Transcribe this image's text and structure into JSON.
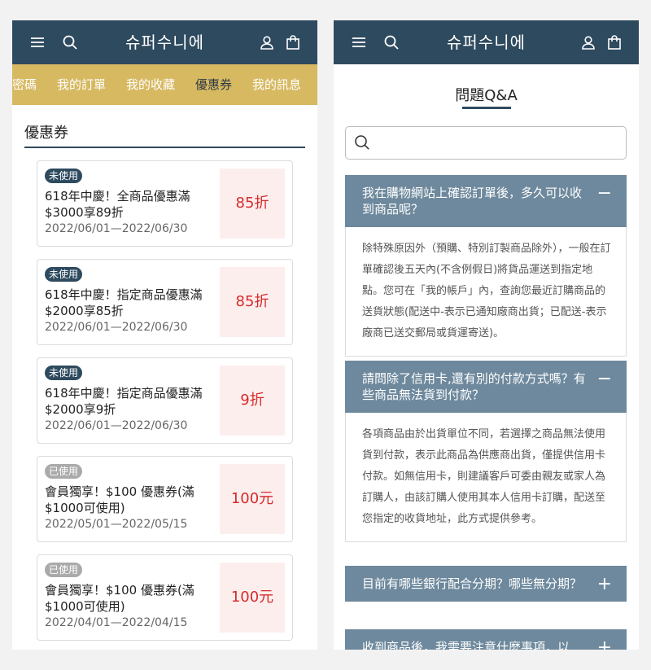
{
  "brand": "슈퍼수니에",
  "left": {
    "subnav": [
      {
        "label": "密碼",
        "active": false
      },
      {
        "label": "我的訂單",
        "active": false
      },
      {
        "label": "我的收藏",
        "active": false
      },
      {
        "label": "優惠券",
        "active": true
      },
      {
        "label": "我的訊息",
        "active": false
      }
    ],
    "section_title": "優惠券",
    "coupons": [
      {
        "status": "未使用",
        "used": false,
        "name": "618年中慶！全商品優惠滿$3000享89折",
        "date": "2022/06/01—2022/06/30",
        "discount": "85折"
      },
      {
        "status": "未使用",
        "used": false,
        "name": "618年中慶！指定商品優惠滿$2000享85折",
        "date": "2022/06/01—2022/06/30",
        "discount": "85折"
      },
      {
        "status": "未使用",
        "used": false,
        "name": "618年中慶！指定商品優惠滿$2000享9折",
        "date": "2022/06/01—2022/06/30",
        "discount": "9折"
      },
      {
        "status": "已使用",
        "used": true,
        "name": "會員獨享！$100 優惠券(滿$1000可使用)",
        "date": "2022/05/01—2022/05/15",
        "discount": "100元"
      },
      {
        "status": "已使用",
        "used": true,
        "name": "會員獨享！$100 優惠券(滿$1000可使用)",
        "date": "2022/04/01—2022/04/15",
        "discount": "100元"
      }
    ]
  },
  "right": {
    "page_title": "問題Q&A",
    "search": {
      "placeholder": "",
      "value": ""
    },
    "faqs": [
      {
        "question": "我在購物網站上確認訂單後，多久可以收到商品呢？",
        "toggle": "−",
        "expanded": true,
        "answer": "除特殊原因外（預購、特別訂製商品除外），一般在訂單確認後五天內(不含例假日)將貨品運送到指定地點。您可在「我的帳戶」內，查詢您最近訂購商品的送貨狀態(配送中-表示已通知廠商出貨；已配送-表示廠商已送交郵局或貨運寄送)。"
      },
      {
        "question": "請問除了信用卡,還有別的付款方式嗎？有些商品無法貨到付款？",
        "toggle": "−",
        "expanded": true,
        "answer": "各項商品由於出貨單位不同，若選擇之商品無法使用貨到付款，表示此商品為供應商出貨，僅提供信用卡付款。如無信用卡，則建議客戶可委由親友或家人為訂購人，由該訂購人使用其本人信用卡訂購，配送至您指定的收貨地址，此方式提供參考。"
      },
      {
        "question": "目前有哪些銀行配合分期？哪些無分期？",
        "toggle": "+",
        "expanded": false,
        "answer": ""
      },
      {
        "question": "收到商品後，我需要注意什麼事項，以",
        "toggle": "+",
        "expanded": false,
        "answer": ""
      }
    ]
  },
  "colors": {
    "header": "#2e4a5f",
    "subnav": "#d7b962",
    "faq_header": "#6e899d",
    "discount_text": "#d62b2b",
    "discount_bg": "#fdeeee"
  }
}
